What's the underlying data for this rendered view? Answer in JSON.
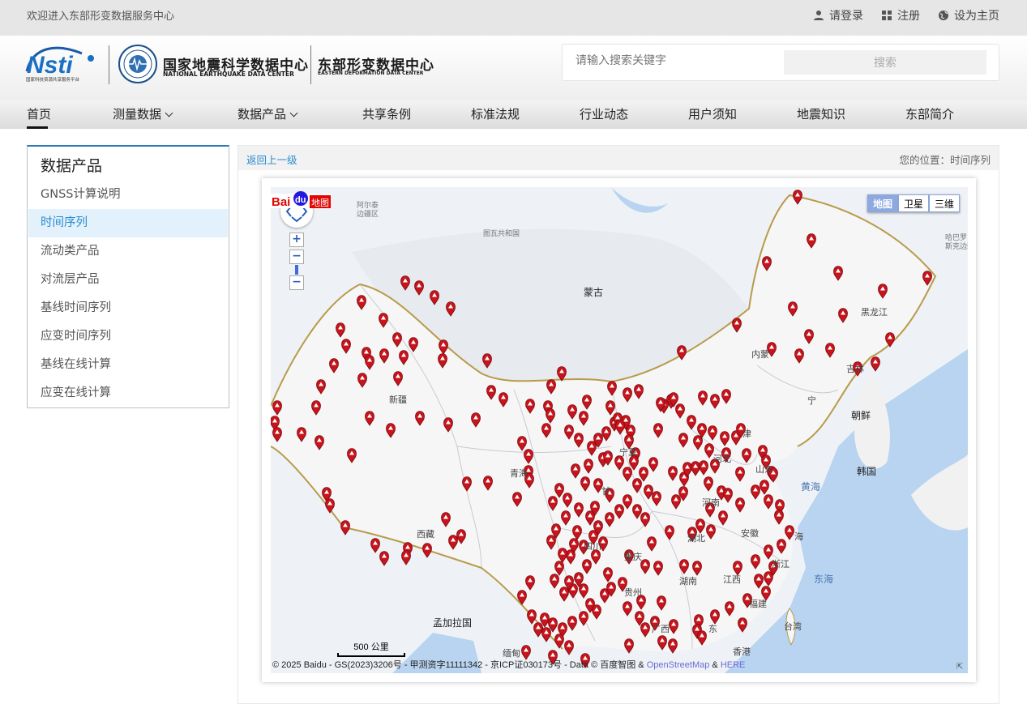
{
  "topbar": {
    "welcome": "欢迎进入东部形变数据服务中心",
    "login": "请登录",
    "register": "注册",
    "homepage": "设为主页"
  },
  "header": {
    "nsti_logo_text": "Nsti",
    "nsti_caption": "国家科技资源共享服务平台",
    "center_cn": "国家地震科学数据中心",
    "center_en": "NATIONAL EARTHQUAKE DATA CENTER",
    "sub_cn": "东部形变数据中心",
    "sub_en": "EASTERN DEFORMATION DATA CENTER"
  },
  "search": {
    "placeholder": "请输入搜索关键字",
    "button": "搜索"
  },
  "nav": {
    "items": [
      {
        "label": "首页",
        "active": true
      },
      {
        "label": "测量数据",
        "dropdown": true
      },
      {
        "label": "数据产品",
        "dropdown": true
      },
      {
        "label": "共享条例"
      },
      {
        "label": "标准法规"
      },
      {
        "label": "行业动态"
      },
      {
        "label": "用户须知"
      },
      {
        "label": "地震知识"
      },
      {
        "label": "东部简介"
      }
    ]
  },
  "sidebar": {
    "title": "数据产品",
    "items": [
      {
        "label": "GNSS计算说明"
      },
      {
        "label": "时间序列",
        "active": true
      },
      {
        "label": "流动类产品"
      },
      {
        "label": "对流层产品"
      },
      {
        "label": "基线时间序列"
      },
      {
        "label": "应变时间序列"
      },
      {
        "label": "基线在线计算"
      },
      {
        "label": "应变在线计算"
      }
    ]
  },
  "content": {
    "back": "返回上一级",
    "location": "您的位置：时间序列"
  },
  "map": {
    "types": [
      {
        "label": "地图",
        "active": true
      },
      {
        "label": "卫星"
      },
      {
        "label": "三维"
      }
    ],
    "scale": "500 公里",
    "copyright_prefix": "© 2025 Baidu - GS(2023)3206号 - 甲测资字11111342 - 京ICP证030173号 - Data © 百度智图 & ",
    "copyright_osm": "OpenStreetMap",
    "copyright_amp": " & ",
    "copyright_here": "HERE",
    "baidu_logo": "Bai du 地图",
    "labels": {
      "mongolia": "蒙古",
      "xinjiang": "新疆",
      "qinghai": "青海",
      "xizang": "西藏",
      "sichuan": "四川",
      "chongqing": "重庆",
      "guizhou": "贵州",
      "hunan": "湖南",
      "hubei": "湖北",
      "jiangxi": "江西",
      "fujian": "福建",
      "guangxi": "广西",
      "guangdong": "东",
      "hongkong": "香港",
      "taiwan": "台湾",
      "henan": "河南",
      "hebei": "河北",
      "shandong": "山东",
      "anhui": "安徽",
      "zhejiang": "浙江",
      "shanghai": "海",
      "ningxia": "宁夏",
      "gansu": "甘",
      "neimenggu": "内蒙",
      "heilongjiang": "黑龙江",
      "jilin": "吉林",
      "liaoning": "宁",
      "tianjin": "津",
      "northkorea": "朝鲜",
      "southkorea": "韩国",
      "yellowsea": "黄海",
      "eastsea": "东海",
      "bangladesh": "孟加拉国",
      "myanmar": "缅甸",
      "russia_asr": "阿尔泰\n边疆区",
      "tuva": "图瓦共和国",
      "khabarovsk": "哈巴罗\n斯克边疆"
    }
  },
  "colors": {
    "accent": "#2a8cd0",
    "marker": "#c8141c",
    "sidebar_border_top": "#2a7ab8"
  }
}
